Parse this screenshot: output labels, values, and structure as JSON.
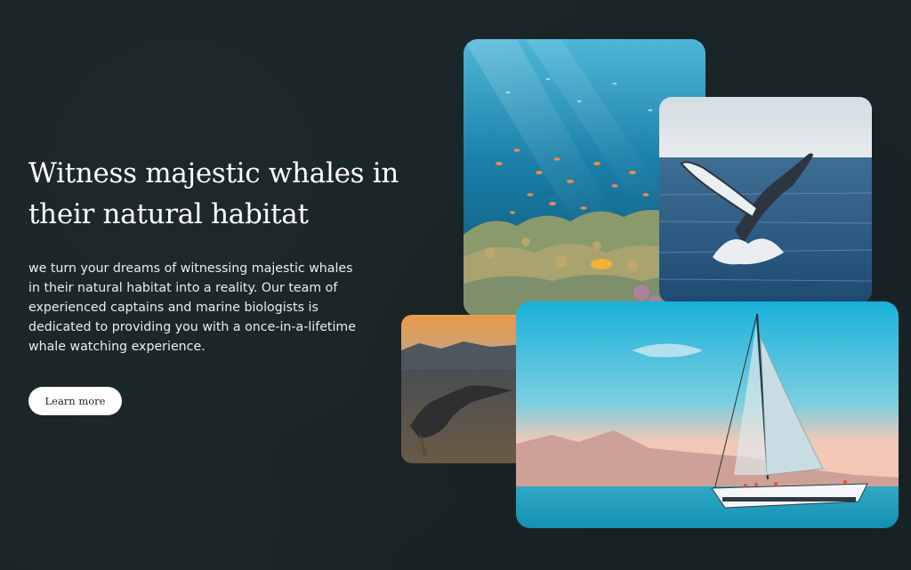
{
  "hero": {
    "title": "Witness majestic whales in their natural habitat",
    "body": "we turn your dreams of witnessing majestic whales in their natural habitat into a reality. Our team of experienced captains and marine biologists is dedicated to providing you with a once-in-a-lifetime whale watching experience.",
    "button_label": "Learn more"
  },
  "gallery": {
    "images": [
      {
        "name": "coral-reef-photo",
        "subject": "coral reef with orange fish"
      },
      {
        "name": "breaching-humpback-photo",
        "subject": "humpback whale breaching"
      },
      {
        "name": "whale-tail-photo",
        "subject": "whale tail at sunset"
      },
      {
        "name": "sailboat-photo",
        "subject": "sailboat at sea"
      }
    ]
  },
  "colors": {
    "background": "#1a2527",
    "text": "#ffffff",
    "button_bg": "#ffffff",
    "button_text": "#1a2527"
  }
}
